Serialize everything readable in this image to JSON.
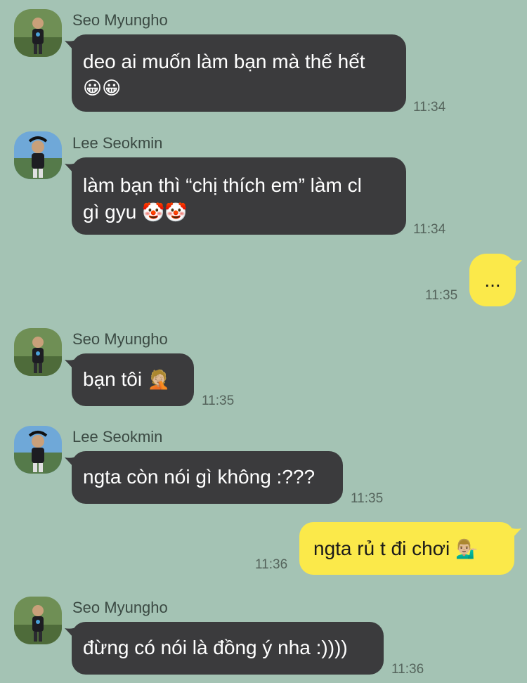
{
  "messages": [
    {
      "sender": "Seo Myungho",
      "text": "deo ai muốn làm bạn mà thế hết",
      "emoji": "😀😀",
      "time": "11:34"
    },
    {
      "sender": "Lee Seokmin",
      "text": "làm bạn thì “chị thích em” làm cl",
      "text2": "gì gyu",
      "emoji": "🤡🤡",
      "time": "11:34"
    },
    {
      "text": "...",
      "time": "11:35"
    },
    {
      "sender": "Seo Myungho",
      "text": "bạn tôi",
      "emoji": "🤦🏼",
      "time": "11:35"
    },
    {
      "sender": "Lee Seokmin",
      "text": "ngta còn nói gì không :???",
      "time": "11:35"
    },
    {
      "text": "ngta rủ t đi chơi",
      "emoji": "💁🏼‍♂️",
      "time": "11:36"
    },
    {
      "sender": "Seo Myungho",
      "text": "đừng có nói là đồng ý nha :))))",
      "time": "11:36"
    }
  ],
  "colors": {
    "background": "#a4c3b4",
    "incoming": "#3b3b3d",
    "outgoing": "#fbe94a"
  },
  "icons": {
    "avatar_seo": "avatar-person-photo",
    "avatar_lee": "avatar-person-photo"
  }
}
